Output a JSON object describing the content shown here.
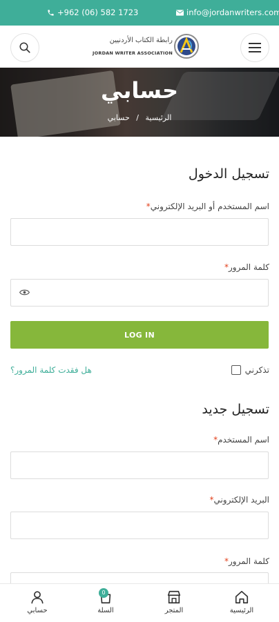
{
  "topbar": {
    "phone": "+962 (06) 582 1723",
    "email": "info@jordanwriters.com",
    "background": "#3fae99"
  },
  "header": {
    "logo_arabic": "رابطة الكتاب الأردنيين",
    "logo_english": "JORDAN WRITER ASSOCIATION"
  },
  "hero": {
    "title": "حسابي",
    "breadcrumb": [
      "الرئيسية",
      "/",
      "حسابي"
    ]
  },
  "login": {
    "title": "تسجيل الدخول",
    "username_label": "اسم المستخدم أو البريد الإلكتروني",
    "password_label": "كلمة المرور",
    "required_mark": "*",
    "button_label": "LOG IN",
    "remember_label": "تذكرني",
    "lost_password": "هل فقدت كلمة المرور؟"
  },
  "register": {
    "title": "تسجيل جديد",
    "username_label": "اسم المستخدم",
    "email_label": "البريد الإلكتروني",
    "password_label": "كلمة المرور",
    "required_mark": "*"
  },
  "bottom_nav": {
    "items": [
      {
        "label": "الرئيسية",
        "icon": "home-icon"
      },
      {
        "label": "المتجر",
        "icon": "store-icon"
      },
      {
        "label": "السلة",
        "icon": "cart-icon",
        "badge": "0"
      },
      {
        "label": "حسابي",
        "icon": "user-icon"
      }
    ]
  },
  "colors": {
    "accent": "#3fae99",
    "login_button": "#86b73b",
    "required": "#e2401c"
  }
}
